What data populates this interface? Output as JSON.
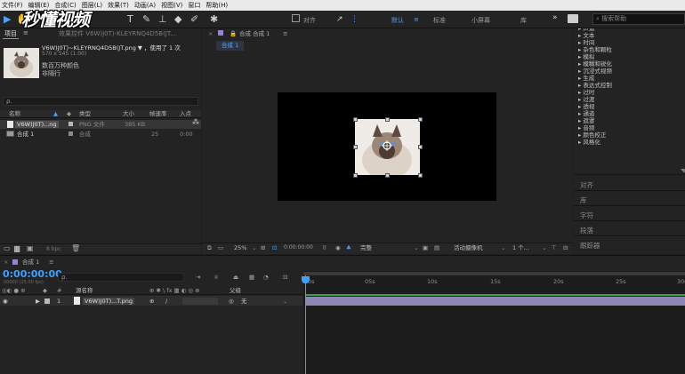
{
  "menu": [
    "文件(F)",
    "编辑(E)",
    "合成(C)",
    "图层(L)",
    "效果(T)",
    "动画(A)",
    "视图(V)",
    "窗口",
    "帮助(H)"
  ],
  "watermark": "秒懂视频",
  "toolbar": {
    "align_label": "对齐",
    "workspaces": [
      "默认",
      "≡",
      "标准",
      "小屏幕",
      "库"
    ],
    "more": "»",
    "search_placeholder": "搜索帮助"
  },
  "project": {
    "tab": "项目",
    "menu_icon": "≡",
    "title_fragment": "效果控件 V6W)J0T)-KLEYRNQ4D5B(JT...",
    "file_name": "V6W)J0T)~KLEYRNQ4D5B(JT.png",
    "used": "，使用了 1 次",
    "dims": "570 x 545 (1.00)",
    "color_line1": "数百万种颜色",
    "color_line2": "非隔行",
    "search_icon": "ρ.",
    "columns": [
      "名称",
      "类型",
      "大小",
      "帧速率",
      "入点"
    ],
    "rows": [
      {
        "name": "V6W)J0T)...ng",
        "type": "PNG 文件",
        "size": "385 KB",
        "fps": "",
        "in": ""
      },
      {
        "name": "合成 1",
        "type": "合成",
        "size": "",
        "fps": "25",
        "in": "0:00"
      }
    ],
    "bpc": "8 bpc"
  },
  "viewer": {
    "tab": "合成 合成 1",
    "menu_icon": "≡",
    "comp_tab": "合成 1",
    "zoom": "25%",
    "timecode": "0:00:00:00",
    "quality": "完整",
    "camera": "活动摄像机",
    "views": "1 个..."
  },
  "right_panel": {
    "effects": [
      "声道",
      "文本",
      "时间",
      "杂色和颗粒",
      "模拟",
      "模糊和锐化",
      "沉浸式视频",
      "生成",
      "表达式控制",
      "过时",
      "过渡",
      "透视",
      "通道",
      "遮罩",
      "音频",
      "颜色校正",
      "风格化"
    ],
    "tabs": [
      "对齐",
      "库",
      "字符",
      "段落",
      "跟踪器"
    ]
  },
  "timeline": {
    "tab": "合成 1",
    "menu_icon": "≡",
    "timecode": "0:00:00:00",
    "frame_info": "00000 (25.00 fps)",
    "search_icon": "ρ.",
    "col_name": "源名称",
    "col_parent": "父级",
    "layer_num": "1",
    "layer_name": "V6W)J0T)...T.png",
    "parent_value": "无",
    "ruler": [
      "0s",
      "05s",
      "10s",
      "15s",
      "20s",
      "25s",
      "30s"
    ]
  }
}
